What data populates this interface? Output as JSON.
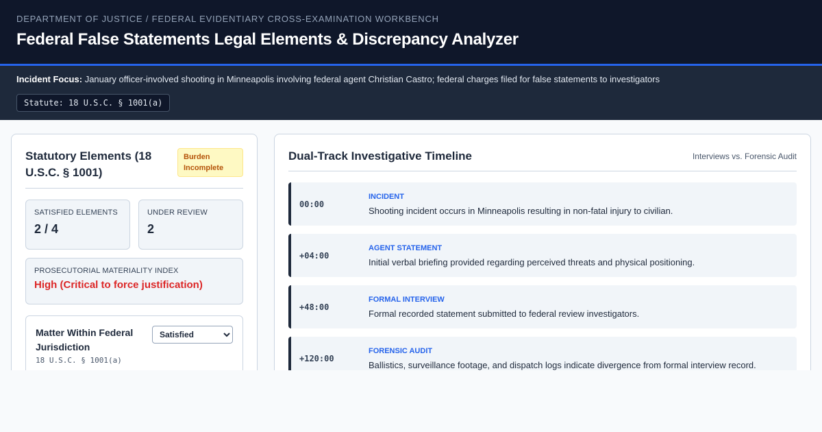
{
  "header": {
    "breadcrumb": "DEPARTMENT OF JUSTICE / FEDERAL EVIDENTIARY CROSS-EXAMINATION WORKBENCH",
    "title": "Federal False Statements Legal Elements & Discrepancy Analyzer"
  },
  "focus": {
    "label": "Incident Focus:",
    "text": "January officer-involved shooting in Minneapolis involving federal agent Christian Castro; federal charges filed for false statements to investigators",
    "statute_chip": "Statute: 18 U.S.C. § 1001(a)"
  },
  "elements_panel": {
    "title": "Statutory Elements (18 U.S.C. § 1001)",
    "badge": "Burden Incomplete",
    "stats": {
      "satisfied_label": "SATISFIED ELEMENTS",
      "satisfied_value": "2 / 4",
      "review_label": "UNDER REVIEW",
      "review_value": "2"
    },
    "materiality": {
      "label": "PROSECUTORIAL MATERIALITY INDEX",
      "value": "High (Critical to force justification)"
    },
    "elements": [
      {
        "title": "Matter Within Federal Jurisdiction",
        "citation": "18 U.S.C. § 1001(a)",
        "status": "Satisfied"
      }
    ]
  },
  "timeline": {
    "title": "Dual-Track Investigative Timeline",
    "subtitle": "Interviews vs. Forensic Audit",
    "items": [
      {
        "time": "00:00",
        "label": "INCIDENT",
        "desc": "Shooting incident occurs in Minneapolis resulting in non-fatal injury to civilian."
      },
      {
        "time": "+04:00",
        "label": "AGENT STATEMENT",
        "desc": "Initial verbal briefing provided regarding perceived threats and physical positioning."
      },
      {
        "time": "+48:00",
        "label": "FORMAL INTERVIEW",
        "desc": "Formal recorded statement submitted to federal review investigators."
      },
      {
        "time": "+120:00",
        "label": "FORENSIC AUDIT",
        "desc": "Ballistics, surveillance footage, and dispatch logs indicate divergence from formal interview record."
      }
    ]
  }
}
